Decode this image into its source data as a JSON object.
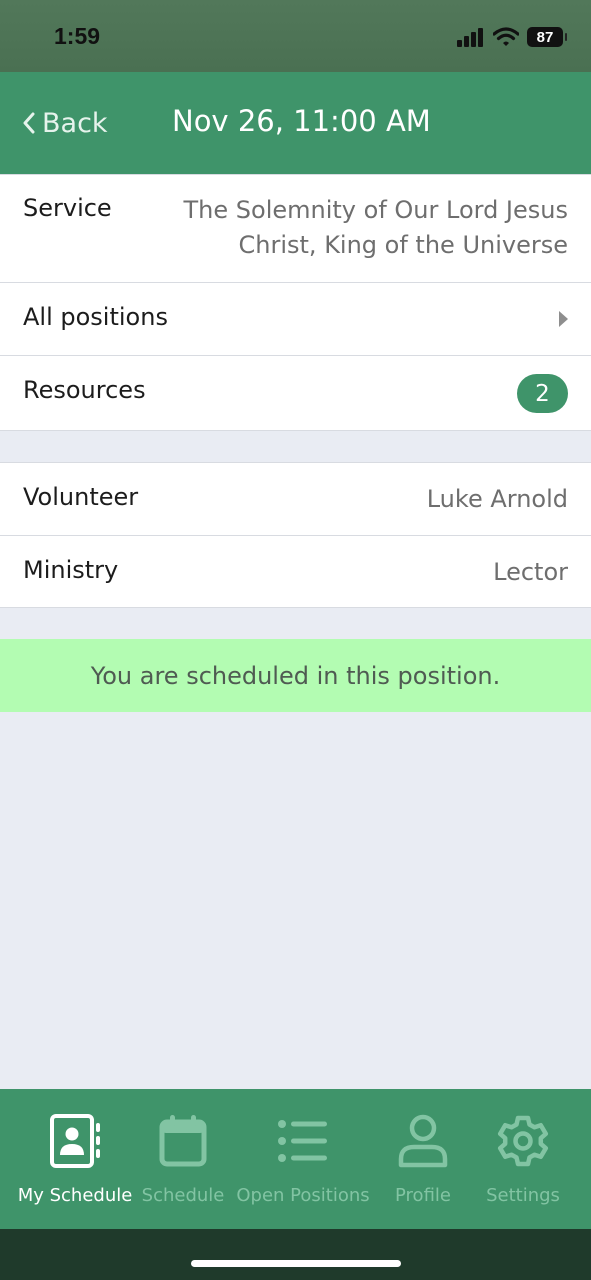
{
  "status": {
    "time": "1:59",
    "battery": "87"
  },
  "nav": {
    "back_label": "Back",
    "title": "Nov 26, 11:00 AM"
  },
  "details": {
    "service_label": "Service",
    "service_value_line1": "The Solemnity of Our Lord Jesus",
    "service_value_line2": "Christ, King of the Universe",
    "positions_label": "All positions",
    "resources_label": "Resources",
    "resources_count": "2"
  },
  "assignment": {
    "volunteer_label": "Volunteer",
    "volunteer_value": "Luke Arnold",
    "ministry_label": "Ministry",
    "ministry_value": "Lector"
  },
  "banner": {
    "text": "You are scheduled in this position."
  },
  "tabs": [
    {
      "label": "My Schedule",
      "icon": "contact-book-icon",
      "active": true
    },
    {
      "label": "Schedule",
      "icon": "calendar-icon",
      "active": false
    },
    {
      "label": "Open Positions",
      "icon": "list-icon",
      "active": false
    },
    {
      "label": "Profile",
      "icon": "person-icon",
      "active": false
    },
    {
      "label": "Settings",
      "icon": "gear-icon",
      "active": false
    }
  ],
  "colors": {
    "brand_green": "#3f946a",
    "banner_green": "#b3fcb2",
    "background": "#e9ecf3"
  }
}
